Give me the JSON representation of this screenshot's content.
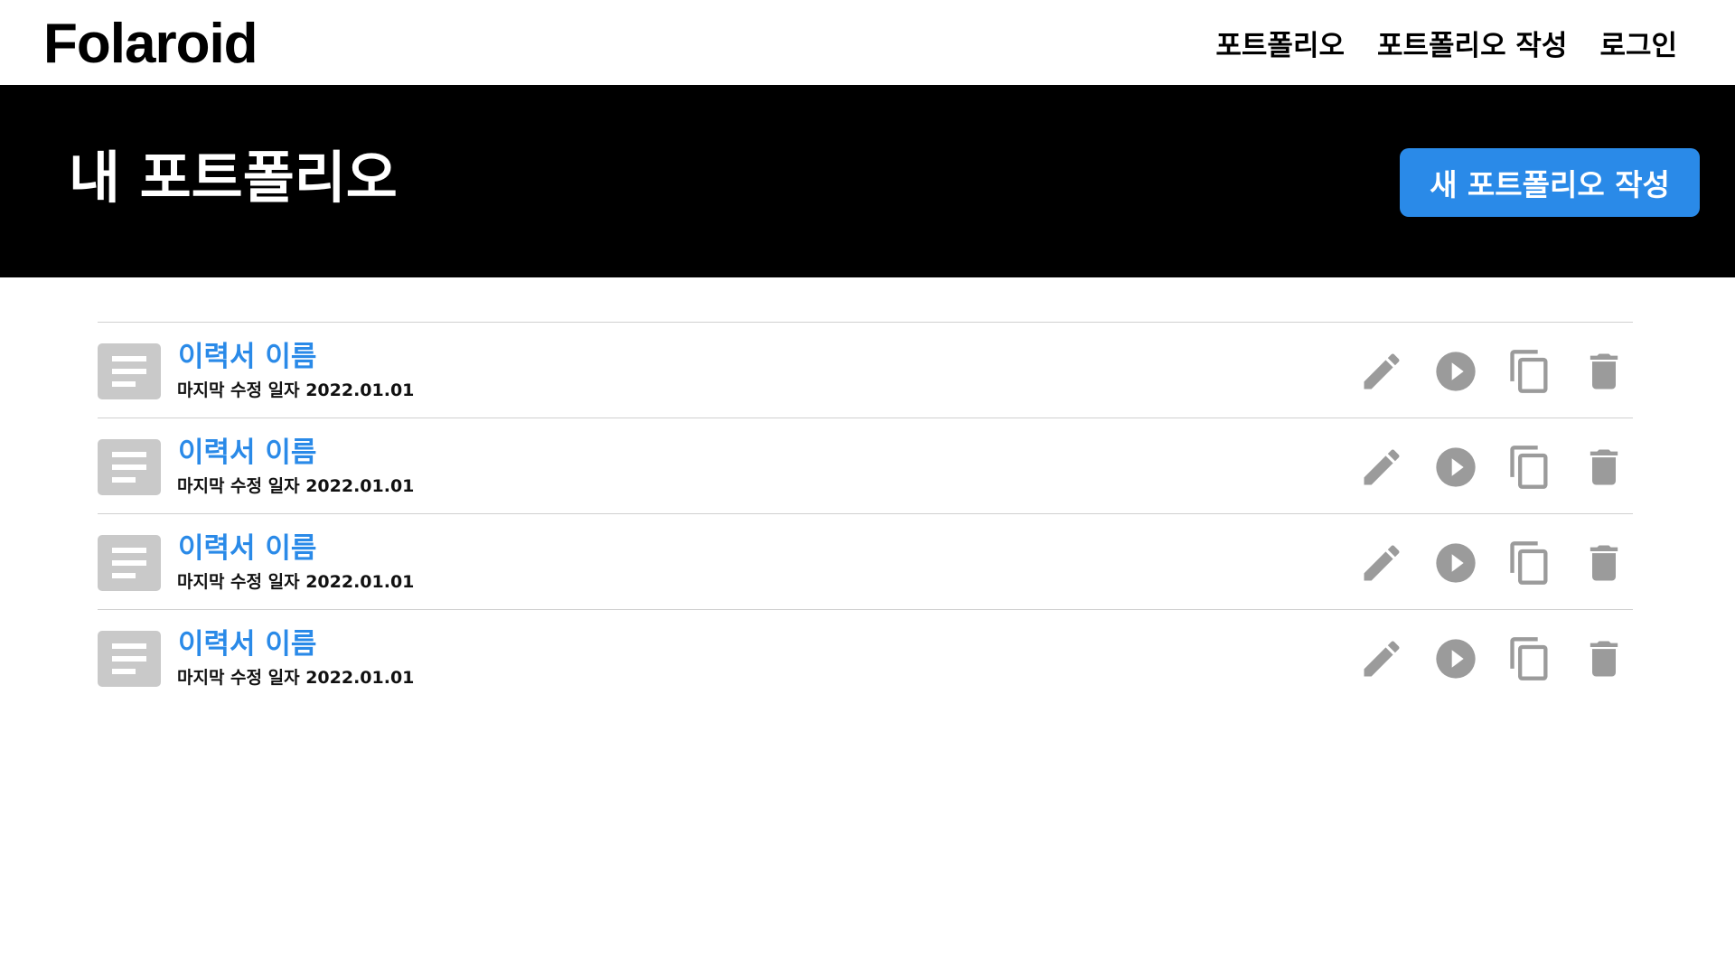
{
  "app": {
    "logo": "Folaroid",
    "nav": [
      {
        "label": "포트폴리오"
      },
      {
        "label": "포트폴리오 작성"
      },
      {
        "label": "로그인"
      }
    ]
  },
  "banner": {
    "title": "내 포트폴리오",
    "new_button_label": "새 포트폴리오 작성"
  },
  "portfolios": [
    {
      "title": "이력서 이름",
      "modified": "마지막 수정 일자 2022.01.01"
    },
    {
      "title": "이력서 이름",
      "modified": "마지막 수정 일자 2022.01.01"
    },
    {
      "title": "이력서 이름",
      "modified": "마지막 수정 일자 2022.01.01"
    },
    {
      "title": "이력서 이름",
      "modified": "마지막 수정 일자 2022.01.01"
    }
  ],
  "icons": {
    "thumbnail": "document-icon",
    "edit": "pencil-icon",
    "preview": "play-icon",
    "duplicate": "copy-icon",
    "delete": "trash-icon"
  },
  "colors": {
    "accent": "#2a8ae8",
    "banner_bg": "#000000",
    "icon_gray": "#9b9b9b",
    "thumb_gray": "#c9c9c9"
  }
}
